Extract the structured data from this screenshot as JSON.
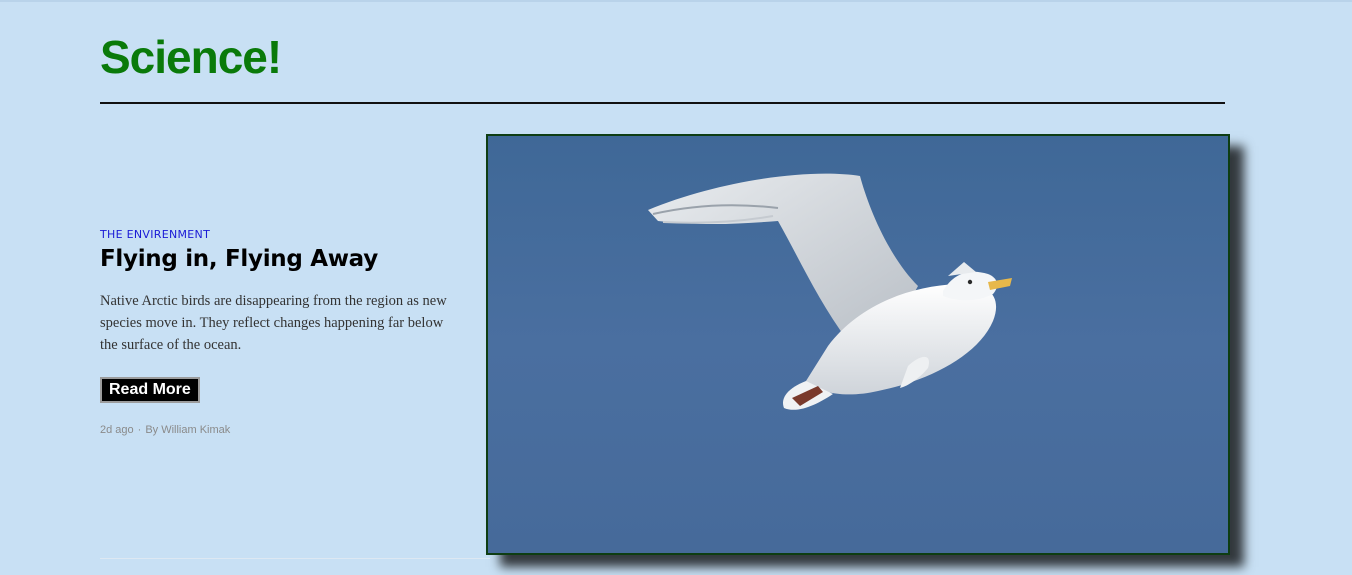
{
  "section": {
    "title": "Science!"
  },
  "article": {
    "category": "THE ENVIRENMENT",
    "headline": "Flying in, Flying Away",
    "summary": "Native Arctic birds are disappearing from the region as new species move in. They reflect changes happening far below the surface of the ocean.",
    "read_more_label": "Read More",
    "age": "2d ago",
    "separator": "·",
    "byline": "By William Kimak",
    "image": {
      "subject": "seagull flying in blue sky",
      "icon": "seagull-photo"
    }
  },
  "colors": {
    "background": "#c8e0f4",
    "title": "#0a7a0a",
    "category": "#1a1ad6",
    "sky": "#466a9a",
    "image_border": "#0e3d12"
  }
}
